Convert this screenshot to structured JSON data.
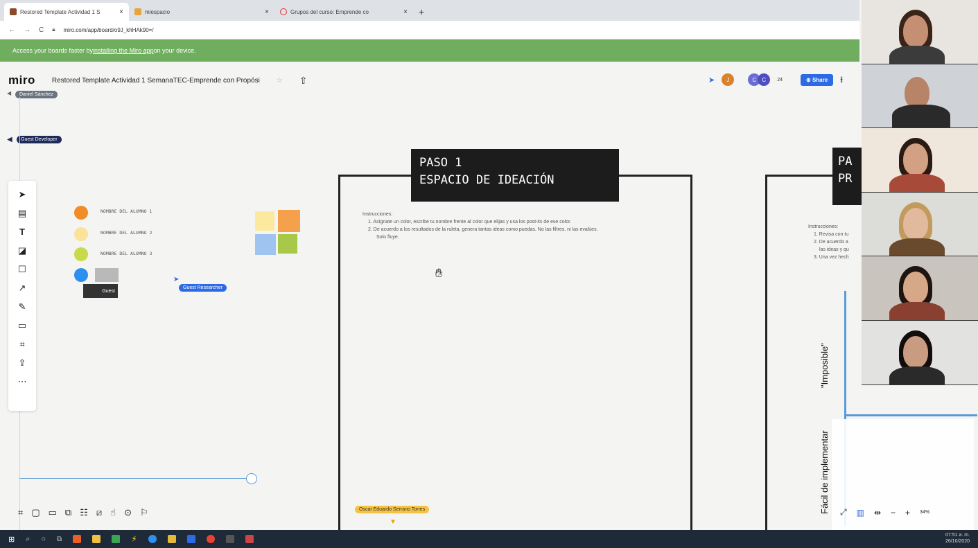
{
  "browser": {
    "tabs": [
      {
        "title": "Restored Template Actividad 1 S",
        "color": "#8b4b2a",
        "active": true
      },
      {
        "title": "miespacio",
        "color": "#e8a33d",
        "active": false
      },
      {
        "title": "Grupos del curso: Emprende co",
        "color": "#d33",
        "active": false
      }
    ],
    "url": "miro.com/app/board/o9J_khHAk90=/"
  },
  "banner": {
    "prefix": "Access your boards faster by ",
    "link": "installing the Miro app",
    "suffix": " on your device."
  },
  "header": {
    "logo": "miro",
    "board_title": "Restored Template Actividad 1 SemanaTEC-Emprende con Propósi",
    "collab_count": "24",
    "share_label": "Share",
    "avatars": [
      "J",
      "C",
      "C"
    ]
  },
  "cursors": {
    "daniel": "Daniel Sánchez",
    "developer": "Guest Developer",
    "researcher": "Guest Researcher",
    "guest": "Guest",
    "oscar": "Oscar Eduardo Serrano Torres"
  },
  "alumnos": [
    "NOMBRE DEL ALUMNO 1",
    "NOMBRE DEL ALUMNO 2",
    "NOMBRE DEL ALUMNO 3"
  ],
  "alumno_colors": [
    "#f28c28",
    "#fbe29a",
    "#c8d94a",
    "#2d8ff0"
  ],
  "sticky_colors": [
    "#fbe9a0",
    "#f5a04a",
    "#9fc4f0",
    "#a8c84a"
  ],
  "step1": {
    "line1": "PASO 1",
    "line2": "ESPACIO DE IDEACIÓN",
    "instructions_title": "Instrucciones:",
    "instr1": "1. Asígnate un color, escribe tu nombre frente al color que elijas y usa los post-its de ese color.",
    "instr2": "2. De acuerdo a los resultados de la ruleta, genera tantas ideas como puedas. No las filtres, ni las evalúes.",
    "instr2b": "Solo fluye."
  },
  "step2": {
    "line1": "PA",
    "line2": "PR",
    "instructions_title": "Instrucciones:",
    "instr1": "1. Revisa con tu",
    "instr2": "2. De acuerdo a",
    "instr2b": "las ideas y qu",
    "instr3": "3. Una vez hech"
  },
  "axis": {
    "imposible": "\"Imposible\"",
    "facil": "Fácil de implementar"
  },
  "zoom": "34%",
  "clock": {
    "time": "07:51 a. m.",
    "date": "26/10/2020"
  },
  "icons": [
    "select-icon",
    "template-icon",
    "text-icon",
    "sticky-note-icon",
    "shape-icon",
    "arrow-icon",
    "pen-icon",
    "comment-icon",
    "frame-icon",
    "upload-icon",
    "more-icon"
  ]
}
